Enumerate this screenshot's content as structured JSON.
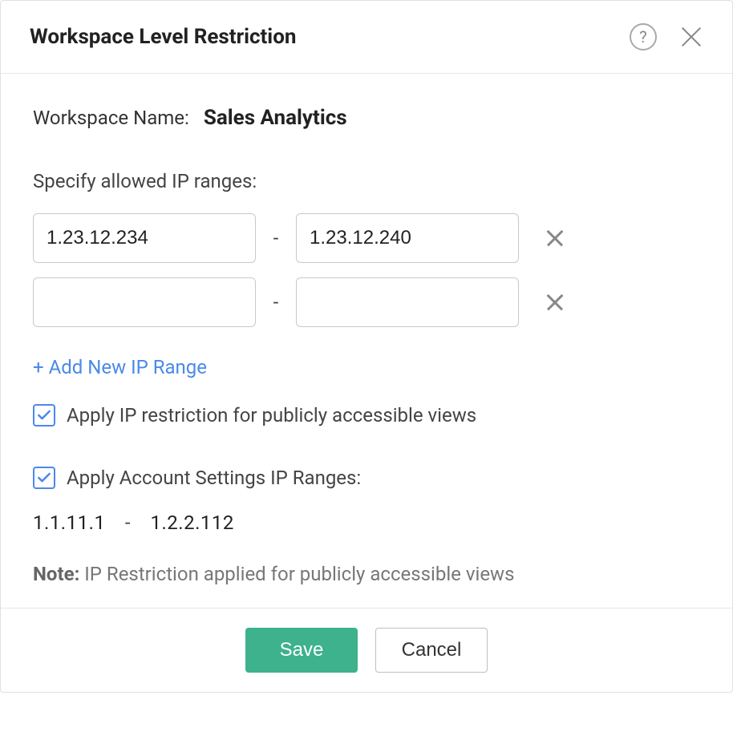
{
  "header": {
    "title": "Workspace Level Restriction"
  },
  "workspace": {
    "label": "Workspace Name:",
    "value": "Sales Analytics"
  },
  "ipSection": {
    "specifyLabel": "Specify allowed IP ranges:",
    "ranges": [
      {
        "from": "1.23.12.234",
        "to": "1.23.12.240"
      },
      {
        "from": "",
        "to": ""
      }
    ],
    "addLinkLabel": "+ Add New IP Range"
  },
  "checkboxes": {
    "publicViews": {
      "checked": true,
      "label": "Apply IP restriction for publicly accessible views"
    },
    "accountSettings": {
      "checked": true,
      "label": "Apply Account Settings IP Ranges:"
    }
  },
  "accountRange": {
    "from": "1.1.11.1",
    "to": "1.2.2.112"
  },
  "note": {
    "prefix": "Note:",
    "text": " IP Restriction applied for publicly accessible views"
  },
  "footer": {
    "saveLabel": "Save",
    "cancelLabel": "Cancel"
  }
}
